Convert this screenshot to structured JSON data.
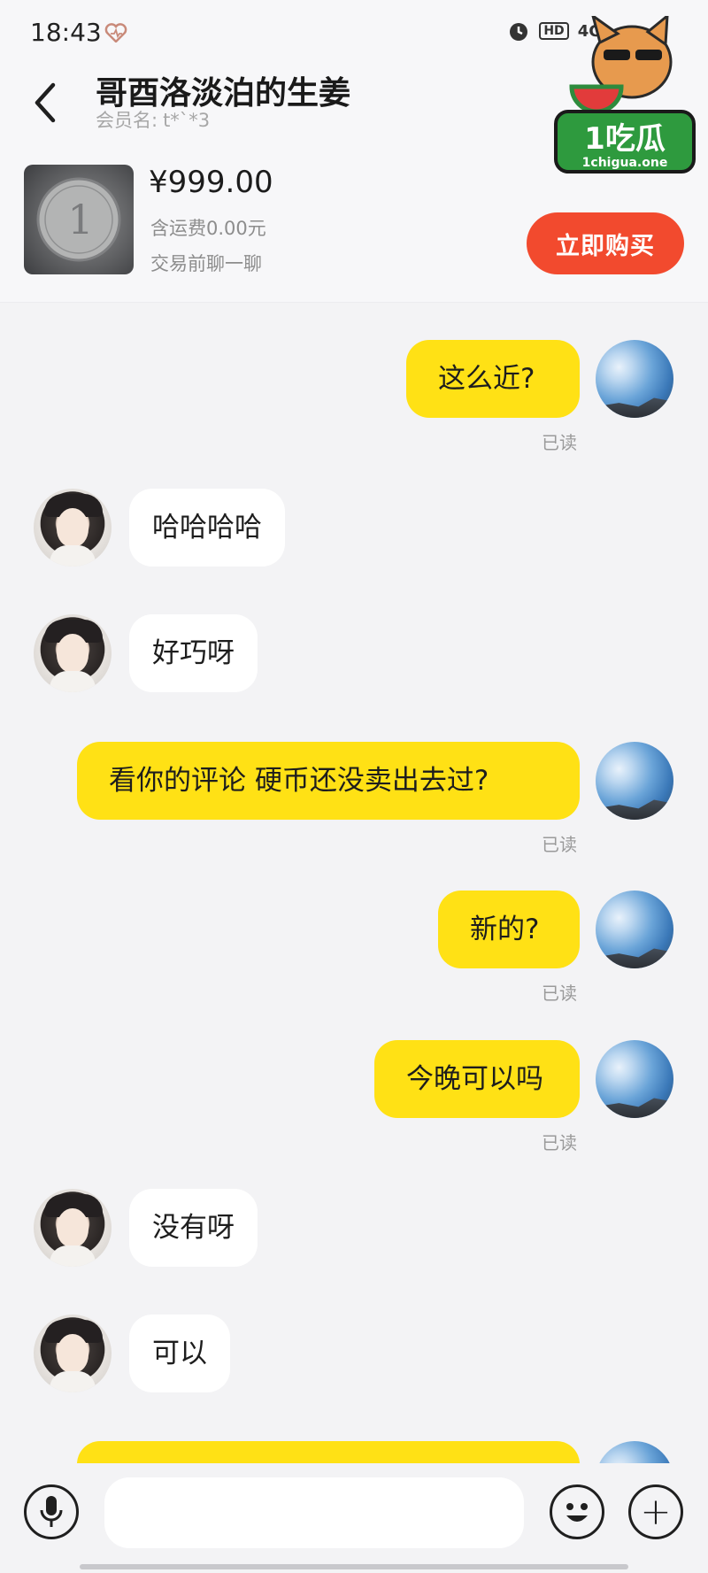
{
  "status_bar": {
    "time": "18:43",
    "icons": [
      "alarm-icon",
      "hd-icon",
      "4g-signal-icon",
      "wifi-icon",
      "battery-icon"
    ],
    "hd_label": "HD",
    "network_label": "4G"
  },
  "header": {
    "title": "哥酉洛淡泊的生姜",
    "member_label": "会员名:",
    "member_name": "t*`*3"
  },
  "watermark": {
    "brand": "1吃瓜",
    "url": "1chigua.one"
  },
  "product": {
    "price": "¥999.00",
    "shipping": "含运费0.00元",
    "hint": "交易前聊一聊",
    "buy_label": "立即购买"
  },
  "messages": [
    {
      "side": "out",
      "text": "这么近?",
      "read": "已读"
    },
    {
      "side": "in",
      "text": "哈哈哈哈"
    },
    {
      "side": "in",
      "text": "好巧呀"
    },
    {
      "side": "out",
      "text": "看你的评论  硬币还没卖出去过?",
      "read": "已读"
    },
    {
      "side": "out",
      "text": "新的?",
      "read": "已读"
    },
    {
      "side": "out",
      "text": "今晚可以吗",
      "read": "已读"
    },
    {
      "side": "in",
      "text": "没有呀"
    },
    {
      "side": "in",
      "text": "可以"
    },
    {
      "side": "out",
      "text": ""
    }
  ],
  "input_bar": {
    "placeholder": ""
  },
  "colors": {
    "outgoing_bubble": "#ffe115",
    "incoming_bubble": "#ffffff",
    "buy_button": "#f24a2e",
    "background": "#f3f3f5"
  }
}
